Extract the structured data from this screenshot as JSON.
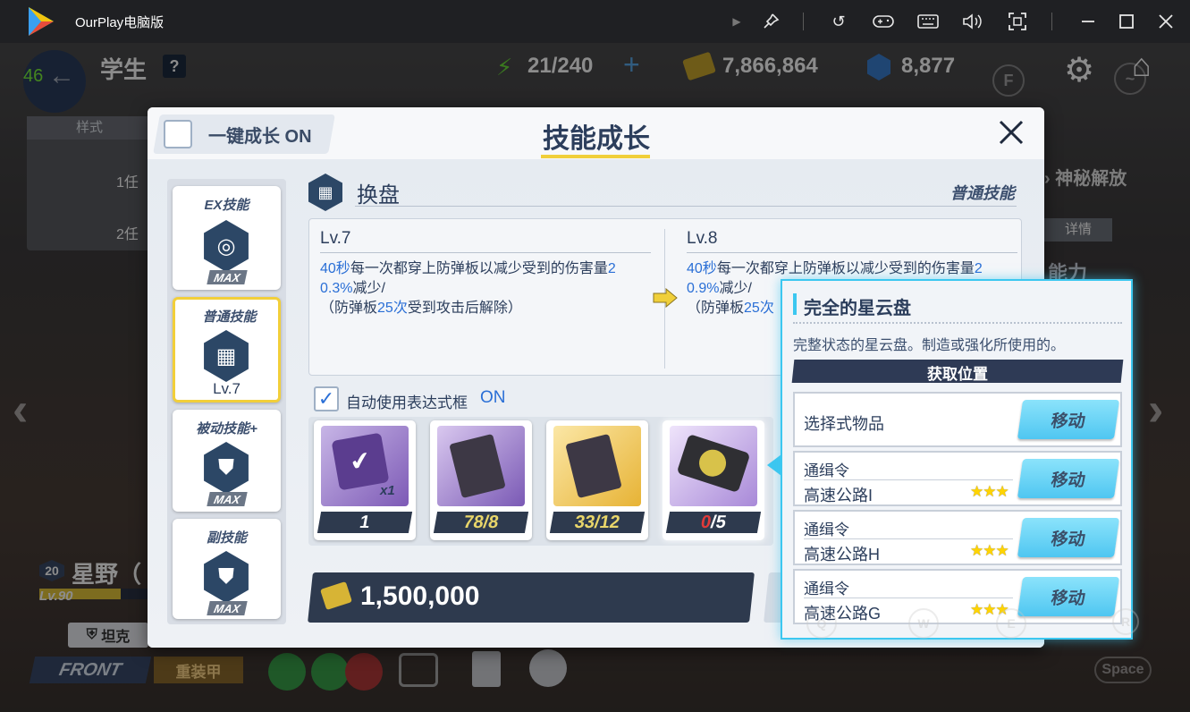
{
  "emulator": {
    "title": "OurPlay电脑版",
    "fps": "46",
    "icons": [
      "play-icon",
      "pin-icon",
      "undo-icon",
      "gamepad-icon",
      "keyboard-icon",
      "volume-icon",
      "fullscreen-icon",
      "minimize-icon",
      "maximize-icon",
      "close-icon"
    ]
  },
  "hud": {
    "page_title": "学生",
    "help": "?",
    "ap": "21/240",
    "credits": "7,866,864",
    "gems": "8,877",
    "plus": "+",
    "key_f": "F",
    "key_tilde": "~",
    "key_space": "Space",
    "key_q": "Q",
    "key_w": "W",
    "key_e": "E",
    "key_r": "R"
  },
  "background": {
    "style_tab": "样式",
    "task1": "1任",
    "task2": "2任",
    "mystery": "神秘解放",
    "detail": "详情",
    "ability": "能力",
    "student_level": "20",
    "student_name": "星野（",
    "student_lv": "Lv.90",
    "role": "坦克",
    "position": "FRONT",
    "armor": "重装甲"
  },
  "dialog": {
    "auto_grow_label": "一键成长 ON",
    "title": "技能成长",
    "skill_name": "换盘",
    "skill_type": "普通技能",
    "sidebar": [
      {
        "label": "EX技能",
        "status": "MAX"
      },
      {
        "label": "普通技能",
        "status": "Lv.7"
      },
      {
        "label": "被动技能+",
        "status": "MAX"
      },
      {
        "label": "副技能",
        "status": "MAX"
      }
    ],
    "current": {
      "level": "Lv.7",
      "hl1": "40秒",
      "t1": "每一次都穿上防弹板以减少受到的伤害量",
      "hl2": "2",
      "hl3": "0.3%",
      "t2": "减少/",
      "t3": "（防弹板",
      "hl4": "25次",
      "t4": "受到攻击后解除）"
    },
    "next": {
      "level": "Lv.8",
      "hl1": "40秒",
      "t1": "每一次都穿上防弹板以减少受到的伤害量",
      "hl2": "2",
      "hl3": "0.9%",
      "t2": "减少/",
      "t3": "（防弹板",
      "hl4": "25次"
    },
    "auto_use_label": "自动使用表达式框",
    "auto_use_state": "ON",
    "materials": [
      {
        "count": "1",
        "qty": "x1"
      },
      {
        "count": "78/8"
      },
      {
        "count": "33/12"
      },
      {
        "count_have": "0",
        "count_need": "/5"
      }
    ],
    "cost": "1,500,000"
  },
  "popup": {
    "title": "完全的星云盘",
    "desc": "完整状态的星云盘。制造或强化所使用的。",
    "section": "获取位置",
    "sources": [
      {
        "line1": "选择式物品",
        "button": "移动"
      },
      {
        "line1": "通缉令",
        "line2": "高速公路I",
        "stars": "★★★",
        "button": "移动"
      },
      {
        "line1": "通缉令",
        "line2": "高速公路H",
        "stars": "★★★",
        "button": "移动"
      },
      {
        "line1": "通缉令",
        "line2": "高速公路G",
        "stars": "★★★",
        "button": "移动"
      }
    ]
  },
  "colors": {
    "accent": "#3cc7f0",
    "highlight_blue": "#2a6fd6",
    "count_ok": "#e9d66a",
    "count_lack": "#e03a3a",
    "dialog_navy": "#2c4766"
  }
}
